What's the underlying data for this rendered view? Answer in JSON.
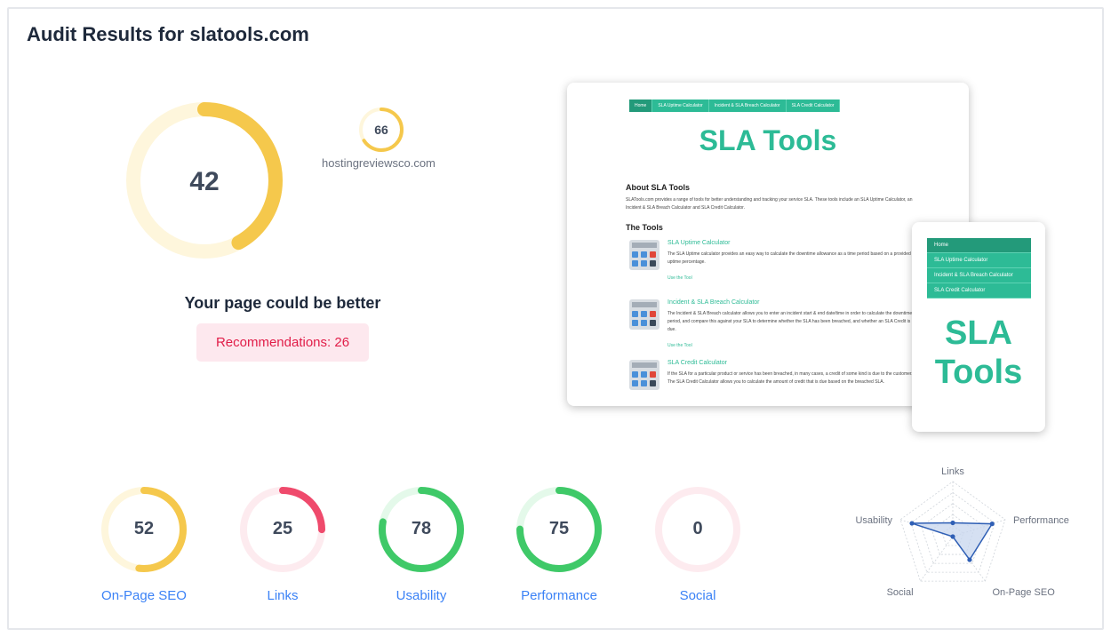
{
  "header": {
    "title": "Audit Results for slatools.com"
  },
  "overall": {
    "score": "42",
    "max": 100,
    "verdict": "Your page could be better",
    "recommendations": "Recommendations: 26",
    "color": "#f5c84c",
    "track": "#fef6dc"
  },
  "competitor": {
    "score": "66",
    "max": 100,
    "domain": "hostingreviewsco.com",
    "color": "#f5c84c",
    "track": "#fef6dc"
  },
  "metrics": [
    {
      "label": "On-Page SEO",
      "score": "52",
      "color": "#f5c84c",
      "track": "#fef6dc"
    },
    {
      "label": "Links",
      "score": "25",
      "color": "#ef4a6c",
      "track": "#fdebef"
    },
    {
      "label": "Usability",
      "score": "78",
      "color": "#3fc968",
      "track": "#e4f9ea"
    },
    {
      "label": "Performance",
      "score": "75",
      "color": "#3fc968",
      "track": "#e4f9ea"
    },
    {
      "label": "Social",
      "score": "0",
      "color": "#ef4a6c",
      "track": "#fdebef"
    }
  ],
  "preview": {
    "nav": [
      "Home",
      "SLA Uptime Calculator",
      "Incident & SLA Breach Calculator",
      "SLA Credit Calculator"
    ],
    "brand": "SLA Tools",
    "about_heading": "About SLA Tools",
    "about_text": "SLATools.com provides a range of tools for better understanding and tracking your service SLA. These tools include an SLA Uptime Calculator, an Incident & SLA Breach Calculator and SLA Credit Calculator.",
    "tools_heading": "The Tools",
    "tools": [
      {
        "title": "SLA Uptime Calculator",
        "desc": "The SLA Uptime calculator provides an easy way to calculate the downtime allowance as a time period based on a provided uptime percentage.",
        "link": "Use the Tool"
      },
      {
        "title": "Incident & SLA Breach Calculator",
        "desc": "The Incident & SLA Breach calculator allows you to enter an incident start & end date/time in order to calculate the downtime period, and compare this against your SLA to determine whether the SLA has been breached, and whether an SLA Credit is due.",
        "link": "Use the Tool"
      },
      {
        "title": "SLA Credit Calculator",
        "desc": "If the SLA for a particular product or service has been breached, in many cases, a credit of some kind is due to the customer. The SLA Credit Calculator allows you to calculate the amount of credit that is due based on the breached SLA.",
        "link": ""
      }
    ],
    "mobile_nav": [
      "Home",
      "SLA Uptime Calculator",
      "Incident & SLA Breach Calculator",
      "SLA Credit Calculator"
    ],
    "mobile_brand": "SLA Tools"
  },
  "radar": {
    "axes": [
      "Links",
      "Performance",
      "On-Page SEO",
      "Social",
      "Usability"
    ],
    "values": [
      25,
      75,
      52,
      0,
      78
    ],
    "max": 100,
    "fill": "#c7d6ee",
    "stroke": "#2f5fb5"
  }
}
